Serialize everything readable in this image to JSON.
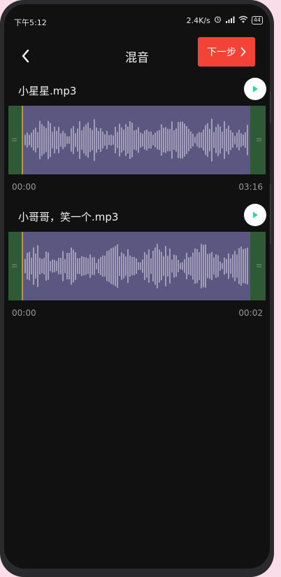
{
  "status_bar": {
    "time": "下午5:12",
    "network_speed": "2.4K/s",
    "battery": "44"
  },
  "header": {
    "title": "混音",
    "next_label": "下一步",
    "accent_color": "#f44336"
  },
  "tracks": [
    {
      "name": "小星星.mp3",
      "start_time": "00:00",
      "end_time": "03:16"
    },
    {
      "name": "小哥哥，笑一个.mp3",
      "start_time": "00:00",
      "end_time": "00:02"
    }
  ],
  "colors": {
    "waveform_fill": "#5b5780",
    "handle_fill": "#2f5a35",
    "playhead": "#f5a623",
    "play_icon": "#3ecf9f"
  },
  "icons": {
    "back": "chevron-left-icon",
    "next": "chevron-right-icon",
    "play": "play-icon",
    "alarm": "alarm-icon",
    "signal": "signal-icon",
    "wifi": "wifi-icon"
  }
}
